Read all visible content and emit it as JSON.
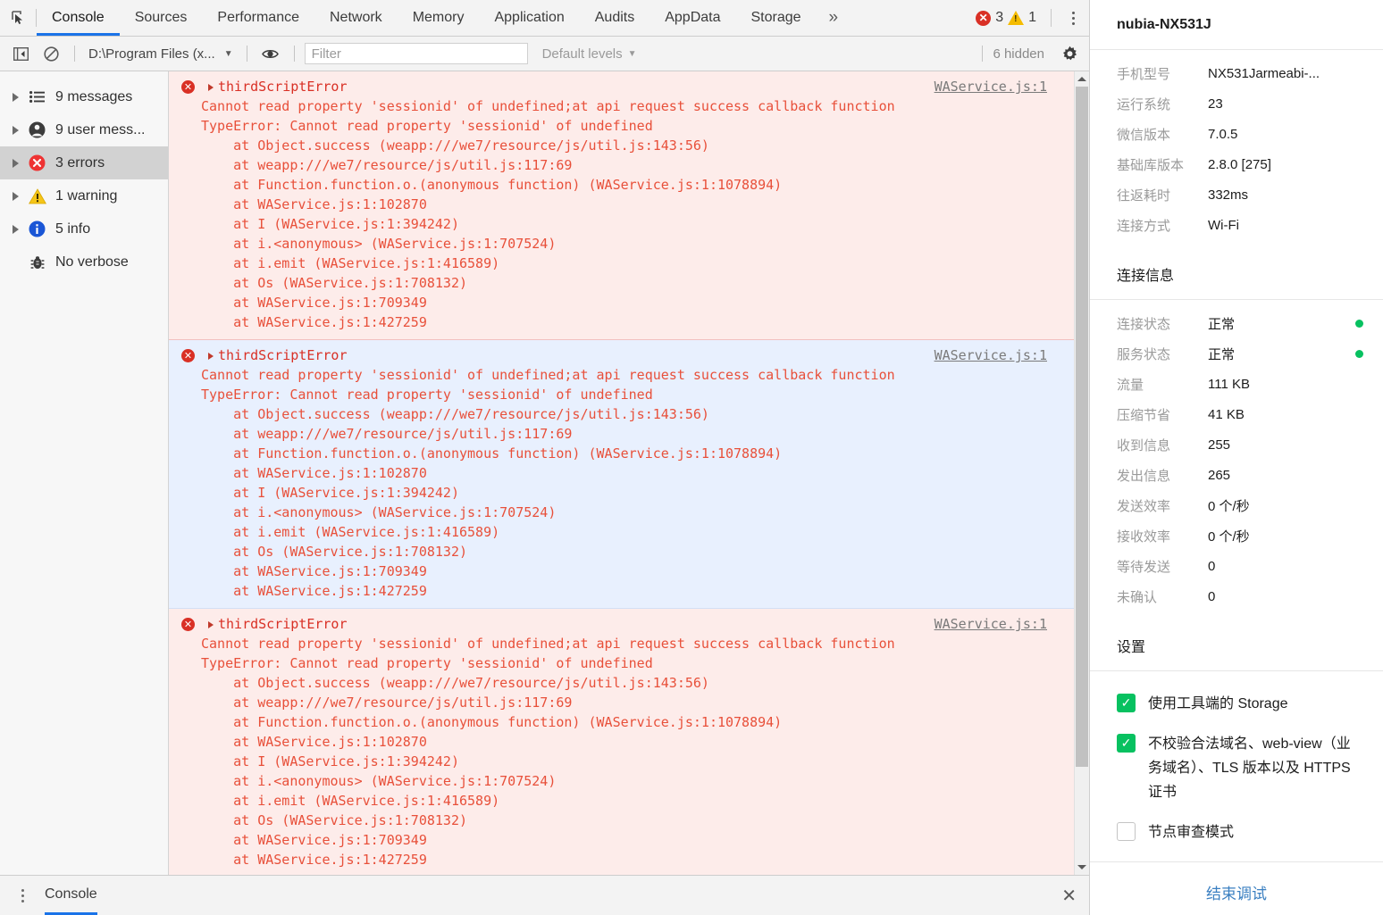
{
  "devtools": {
    "cursor_icon": "inspect-cursor-icon",
    "tabs": [
      {
        "label": "Console",
        "active": true
      },
      {
        "label": "Sources",
        "active": false
      },
      {
        "label": "Performance",
        "active": false
      },
      {
        "label": "Network",
        "active": false
      },
      {
        "label": "Memory",
        "active": false
      },
      {
        "label": "Application",
        "active": false
      },
      {
        "label": "Audits",
        "active": false
      },
      {
        "label": "AppData",
        "active": false
      },
      {
        "label": "Storage",
        "active": false
      }
    ],
    "more_tabs_icon": "chevron-double-right-icon",
    "error_count": "3",
    "warning_count": "1",
    "menu_icon": "kebab-menu-icon",
    "toolbar": {
      "sidebar_toggle_icon": "sidebar-toggle-icon",
      "clear_icon": "clear-console-icon",
      "context": "D:\\Program Files (x...",
      "context_caret": "▼",
      "eye_icon": "live-expression-icon",
      "filter_placeholder": "Filter",
      "filter_value": "",
      "levels_label": "Default levels",
      "levels_caret": "▼",
      "hidden_label": "6 hidden",
      "settings_icon": "gear-icon"
    },
    "sidebar": [
      {
        "label": "9 messages",
        "icon": "list-icon",
        "selected": false,
        "expandable": true
      },
      {
        "label": "9 user mess...",
        "icon": "user-icon",
        "selected": false,
        "expandable": true
      },
      {
        "label": "3 errors",
        "icon": "error-icon",
        "selected": true,
        "expandable": true
      },
      {
        "label": "1 warning",
        "icon": "warning-icon",
        "selected": false,
        "expandable": true
      },
      {
        "label": "5 info",
        "icon": "info-icon",
        "selected": false,
        "expandable": true
      },
      {
        "label": "No verbose",
        "icon": "bug-icon",
        "selected": false,
        "expandable": false
      }
    ],
    "messages": [
      {
        "level": "error",
        "selected": false,
        "title": "thirdScriptError",
        "source": "WAService.js:1",
        "lines": [
          "Cannot read property 'sessionid' of undefined;at api request success callback function",
          "TypeError: Cannot read property 'sessionid' of undefined",
          "    at Object.success (weapp:///we7/resource/js/util.js:143:56)",
          "    at weapp:///we7/resource/js/util.js:117:69",
          "    at Function.function.o.(anonymous function) (WAService.js:1:1078894)",
          "    at WAService.js:1:102870",
          "    at I (WAService.js:1:394242)",
          "    at i.<anonymous> (WAService.js:1:707524)",
          "    at i.emit (WAService.js:1:416589)",
          "    at Os (WAService.js:1:708132)",
          "    at WAService.js:1:709349",
          "    at WAService.js:1:427259"
        ]
      },
      {
        "level": "error",
        "selected": true,
        "title": "thirdScriptError",
        "source": "WAService.js:1",
        "lines": [
          "Cannot read property 'sessionid' of undefined;at api request success callback function",
          "TypeError: Cannot read property 'sessionid' of undefined",
          "    at Object.success (weapp:///we7/resource/js/util.js:143:56)",
          "    at weapp:///we7/resource/js/util.js:117:69",
          "    at Function.function.o.(anonymous function) (WAService.js:1:1078894)",
          "    at WAService.js:1:102870",
          "    at I (WAService.js:1:394242)",
          "    at i.<anonymous> (WAService.js:1:707524)",
          "    at i.emit (WAService.js:1:416589)",
          "    at Os (WAService.js:1:708132)",
          "    at WAService.js:1:709349",
          "    at WAService.js:1:427259"
        ]
      },
      {
        "level": "error",
        "selected": false,
        "title": "thirdScriptError",
        "source": "WAService.js:1",
        "lines": [
          "Cannot read property 'sessionid' of undefined;at api request success callback function",
          "TypeError: Cannot read property 'sessionid' of undefined",
          "    at Object.success (weapp:///we7/resource/js/util.js:143:56)",
          "    at weapp:///we7/resource/js/util.js:117:69",
          "    at Function.function.o.(anonymous function) (WAService.js:1:1078894)",
          "    at WAService.js:1:102870",
          "    at I (WAService.js:1:394242)",
          "    at i.<anonymous> (WAService.js:1:707524)",
          "    at i.emit (WAService.js:1:416589)",
          "    at Os (WAService.js:1:708132)",
          "    at WAService.js:1:709349",
          "    at WAService.js:1:427259"
        ]
      }
    ],
    "prompt": ">",
    "drawer": {
      "menu_icon": "kebab-menu-icon",
      "tab_label": "Console",
      "close_icon": "close-icon"
    }
  },
  "panel": {
    "device_name": "nubia-NX531J",
    "device_info": [
      {
        "key": "手机型号",
        "value": "NX531Jarmeabi-..."
      },
      {
        "key": "运行系统",
        "value": "23"
      },
      {
        "key": "微信版本",
        "value": "7.0.5"
      },
      {
        "key": "基础库版本",
        "value": "2.8.0 [275]"
      },
      {
        "key": "往返耗时",
        "value": "332ms"
      },
      {
        "key": "连接方式",
        "value": "Wi-Fi"
      }
    ],
    "connection_title": "连接信息",
    "connection_info": [
      {
        "key": "连接状态",
        "value": "正常",
        "status_dot": "#07c160"
      },
      {
        "key": "服务状态",
        "value": "正常",
        "status_dot": "#07c160"
      },
      {
        "key": "流量",
        "value": "111 KB",
        "status_dot": ""
      },
      {
        "key": "压缩节省",
        "value": "41 KB",
        "status_dot": ""
      },
      {
        "key": "收到信息",
        "value": "255",
        "status_dot": ""
      },
      {
        "key": "发出信息",
        "value": "265",
        "status_dot": ""
      },
      {
        "key": "发送效率",
        "value": "0 个/秒",
        "status_dot": ""
      },
      {
        "key": "接收效率",
        "value": "0 个/秒",
        "status_dot": ""
      },
      {
        "key": "等待发送",
        "value": "0",
        "status_dot": ""
      },
      {
        "key": "未确认",
        "value": "0",
        "status_dot": ""
      }
    ],
    "settings_title": "设置",
    "settings": [
      {
        "label": "使用工具端的 Storage",
        "checked": true
      },
      {
        "label": "不校验合法域名、web-view（业务域名）、TLS 版本以及 HTTPS 证书",
        "checked": true
      },
      {
        "label": "节点审查模式",
        "checked": false
      }
    ],
    "end_button": "结束调试"
  },
  "colors": {
    "accent": "#1a73e8",
    "error": "#d93025",
    "warning": "#f5bc00",
    "success": "#07c160",
    "error_bg": "#fdecea",
    "selected_bg": "#e8f0fe"
  }
}
